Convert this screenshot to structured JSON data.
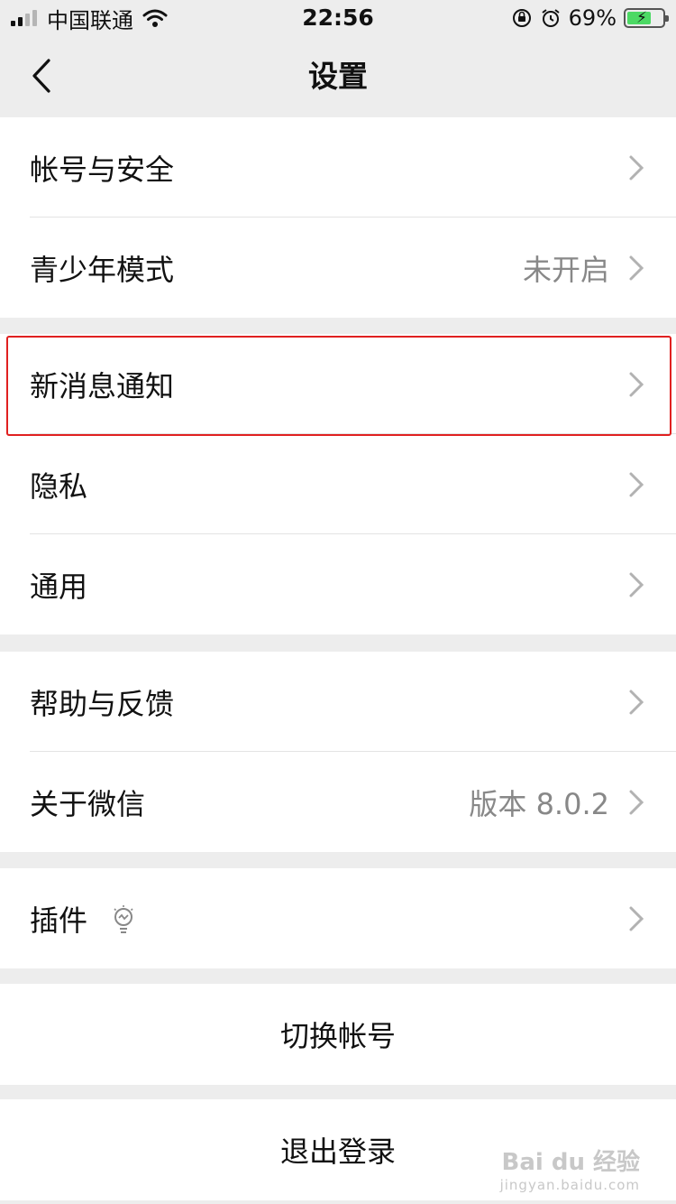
{
  "status_bar": {
    "carrier": "中国联通",
    "time": "22:56",
    "battery_percent": "69%"
  },
  "nav": {
    "title": "设置",
    "back_icon": "chevron-left-icon"
  },
  "groups": [
    {
      "items": [
        {
          "label": "帐号与安全",
          "value": ""
        },
        {
          "label": "青少年模式",
          "value": "未开启"
        }
      ]
    },
    {
      "items": [
        {
          "label": "新消息通知",
          "value": ""
        },
        {
          "label": "隐私",
          "value": ""
        },
        {
          "label": "通用",
          "value": ""
        }
      ]
    },
    {
      "items": [
        {
          "label": "帮助与反馈",
          "value": ""
        },
        {
          "label": "关于微信",
          "value": "版本 8.0.2"
        }
      ]
    },
    {
      "items": [
        {
          "label": "插件",
          "value": "",
          "icon": "lightbulb-icon"
        }
      ]
    }
  ],
  "actions": {
    "switch_account": "切换帐号",
    "logout": "退出登录"
  },
  "watermark": {
    "brand": "Bai du 经验",
    "url": "jingyan.baidu.com"
  },
  "colors": {
    "background": "#ededed",
    "highlight_border": "#e02020",
    "battery_fill": "#4cd964"
  }
}
